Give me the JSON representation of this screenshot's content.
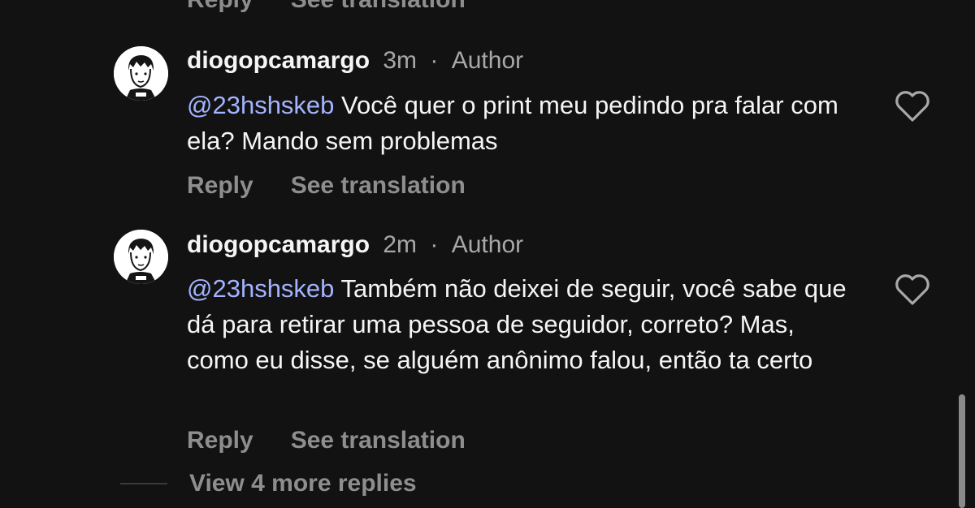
{
  "clipped_actions": {
    "reply_label": "Reply",
    "translate_label": "See translation"
  },
  "comments": [
    {
      "username": "diogopcamargo",
      "time": "3m",
      "separator": "·",
      "role": "Author",
      "mention": "@23hshskeb",
      "text": " Você quer o print meu pedindo pra falar com ela? Mando sem problemas",
      "reply_label": "Reply",
      "translate_label": "See translation",
      "like_icon": "heart-outline-icon"
    },
    {
      "username": "diogopcamargo",
      "time": "2m",
      "separator": "·",
      "role": "Author",
      "mention": "@23hshskeb",
      "text": " Também não deixei de seguir, você sabe que dá para retirar uma pessoa de seguidor, correto? Mas, como eu disse, se alguém anônimo falou, então ta certo",
      "reply_label": "Reply",
      "translate_label": "See translation",
      "like_icon": "heart-outline-icon"
    }
  ],
  "view_more": {
    "label": "View 4 more replies"
  },
  "colors": {
    "background": "#121212",
    "primary_text": "#f5f5f5",
    "secondary_text": "#8e8e8e",
    "mention": "#a3b3ff"
  }
}
